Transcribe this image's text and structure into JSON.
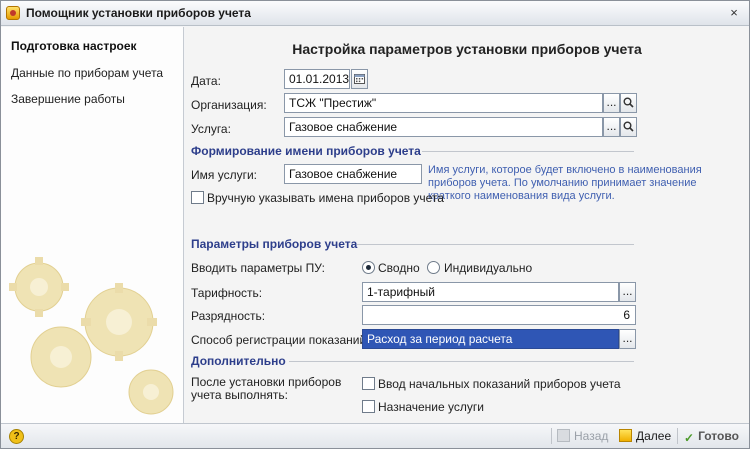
{
  "window": {
    "title": "Помощник установки приборов учета",
    "close_glyph": "×"
  },
  "sidebar": {
    "items": [
      {
        "label": "Подготовка настроек",
        "active": true
      },
      {
        "label": "Данные по приборам учета",
        "active": false
      },
      {
        "label": "Завершение работы",
        "active": false
      }
    ]
  },
  "main": {
    "title": "Настройка параметров установки приборов учета",
    "date": {
      "label": "Дата:",
      "value": "01.01.2013",
      "icon": "calendar-icon"
    },
    "organization": {
      "label": "Организация:",
      "value": "ТСЖ \"Престиж\"",
      "select_glyph": "...",
      "icon": "search-icon"
    },
    "service": {
      "label": "Услуга:",
      "value": "Газовое снабжение",
      "select_glyph": "...",
      "icon": "search-icon"
    },
    "naming_section": {
      "title": "Формирование имени приборов учета",
      "service_name_label": "Имя услуги:",
      "service_name_value": "Газовое снабжение",
      "manual_names_label": "Вручную указывать имена приборов учета",
      "manual_names_checked": false,
      "hint": "Имя услуги, которое будет включено в наименования приборов учета. По умолчанию принимает значение краткого наименования вида услуги."
    },
    "params_section": {
      "title": "Параметры приборов учета",
      "input_mode_label": "Вводить параметры ПУ:",
      "input_mode_options": [
        {
          "label": "Сводно",
          "checked": true
        },
        {
          "label": "Индивидуально",
          "checked": false
        }
      ],
      "tariff_label": "Тарифность:",
      "tariff_value": "1-тарифный",
      "digits_label": "Разрядность:",
      "digits_value": "6",
      "reg_method_label": "Способ регистрации показаний:",
      "reg_method_value": "Расход за период расчета",
      "select_glyph": "..."
    },
    "extra_section": {
      "title": "Дополнительно",
      "after_label_line1": "После установки приборов",
      "after_label_line2": "учета выполнять:",
      "options": [
        {
          "label": "Ввод начальных показаний приборов учета",
          "checked": false
        },
        {
          "label": "Назначение услуги",
          "checked": false
        }
      ]
    }
  },
  "footer": {
    "help_glyph": "?",
    "back_label": "Назад",
    "next_label": "Далее",
    "done_label": "Готово",
    "done_glyph": "✓"
  },
  "colors": {
    "section_title": "#2d3e8b",
    "hint_text": "#3f5fb0",
    "selected_field": "#2f56b5"
  }
}
